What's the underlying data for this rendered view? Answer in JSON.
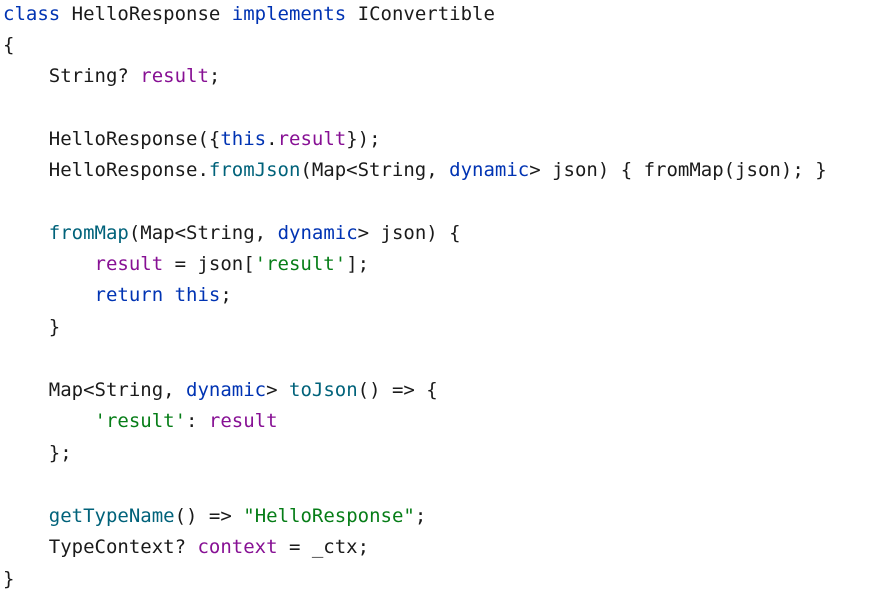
{
  "lines": [
    [
      {
        "t": "class",
        "c": "kw"
      },
      {
        "t": " HelloResponse ",
        "c": "plain"
      },
      {
        "t": "implements",
        "c": "kw"
      },
      {
        "t": " IConvertible",
        "c": "plain"
      }
    ],
    [
      {
        "t": "{",
        "c": "plain"
      }
    ],
    [
      {
        "t": "    String? ",
        "c": "plain"
      },
      {
        "t": "result",
        "c": "fld"
      },
      {
        "t": ";",
        "c": "plain"
      }
    ],
    [
      {
        "t": "    HelloResponse({",
        "c": "plain"
      },
      {
        "t": "this",
        "c": "kw"
      },
      {
        "t": ".",
        "c": "plain"
      },
      {
        "t": "result",
        "c": "fld"
      },
      {
        "t": "});",
        "c": "plain"
      }
    ],
    [
      {
        "t": "    HelloResponse.",
        "c": "plain"
      },
      {
        "t": "fromJson",
        "c": "fn"
      },
      {
        "t": "(Map<String, ",
        "c": "plain"
      },
      {
        "t": "dynamic",
        "c": "kw"
      },
      {
        "t": "> json) { fromMap(json); }",
        "c": "plain"
      }
    ],
    [
      {
        "t": "    ",
        "c": "plain"
      },
      {
        "t": "fromMap",
        "c": "fn"
      },
      {
        "t": "(Map<String, ",
        "c": "plain"
      },
      {
        "t": "dynamic",
        "c": "kw"
      },
      {
        "t": "> json) {",
        "c": "plain"
      }
    ],
    [
      {
        "t": "        ",
        "c": "plain"
      },
      {
        "t": "result",
        "c": "fld"
      },
      {
        "t": " = json[",
        "c": "plain"
      },
      {
        "t": "'result'",
        "c": "str"
      },
      {
        "t": "];",
        "c": "plain"
      }
    ],
    [
      {
        "t": "        ",
        "c": "plain"
      },
      {
        "t": "return",
        "c": "kw"
      },
      {
        "t": " ",
        "c": "plain"
      },
      {
        "t": "this",
        "c": "kw"
      },
      {
        "t": ";",
        "c": "plain"
      }
    ],
    [
      {
        "t": "    }",
        "c": "plain"
      }
    ],
    [
      {
        "t": "    Map<String, ",
        "c": "plain"
      },
      {
        "t": "dynamic",
        "c": "kw"
      },
      {
        "t": "> ",
        "c": "plain"
      },
      {
        "t": "toJson",
        "c": "fn"
      },
      {
        "t": "() => {",
        "c": "plain"
      }
    ],
    [
      {
        "t": "        ",
        "c": "plain"
      },
      {
        "t": "'result'",
        "c": "str"
      },
      {
        "t": ": ",
        "c": "plain"
      },
      {
        "t": "result",
        "c": "fld"
      }
    ],
    [
      {
        "t": "    };",
        "c": "plain"
      }
    ],
    [
      {
        "t": "    ",
        "c": "plain"
      },
      {
        "t": "getTypeName",
        "c": "fn"
      },
      {
        "t": "() => ",
        "c": "plain"
      },
      {
        "t": "\"HelloResponse\"",
        "c": "str"
      },
      {
        "t": ";",
        "c": "plain"
      }
    ],
    [
      {
        "t": "    TypeContext? ",
        "c": "plain"
      },
      {
        "t": "context",
        "c": "fld"
      },
      {
        "t": " = _ctx;",
        "c": "plain"
      }
    ],
    [
      {
        "t": "}",
        "c": "plain"
      }
    ]
  ]
}
